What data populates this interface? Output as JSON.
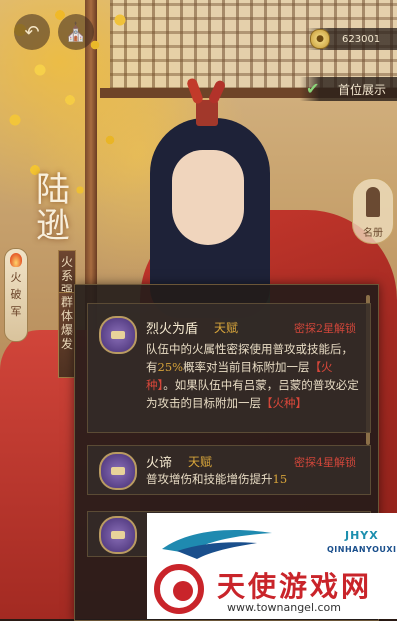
{
  "top_bar": {
    "currency_value": "623001",
    "showcase_label": "首位展示"
  },
  "character": {
    "name_chars": [
      "陆",
      "逊"
    ],
    "tags": [
      "火系强化",
      "群体爆发"
    ],
    "side_badge_chars": [
      "火",
      "破",
      "军"
    ],
    "famous_book_label": "名册"
  },
  "skills": [
    {
      "name": "烈火为盾",
      "type": "天赋",
      "unlock": "密探2星解锁",
      "desc_parts": [
        {
          "t": "队伍中的火属性密探使用普攻或技能后，有",
          "c": ""
        },
        {
          "t": "25%",
          "c": "hl"
        },
        {
          "t": "概率对当前目标附加一层",
          "c": ""
        },
        {
          "t": "【火种】",
          "c": "red"
        },
        {
          "t": "。如果队伍中有吕蒙，吕蒙的普攻必定为攻击的目标附加一层",
          "c": ""
        },
        {
          "t": "【火种】",
          "c": "red"
        }
      ]
    },
    {
      "name": "火谛",
      "type": "天赋",
      "unlock": "密探4星解锁",
      "desc_parts": [
        {
          "t": "普攻增伤和技能增伤提升",
          "c": ""
        },
        {
          "t": "15",
          "c": "hl"
        }
      ]
    }
  ],
  "watermark": {
    "code": "JHYX",
    "pinyin": "QINHANYOUXI",
    "title": "天使游戏网",
    "url": "www.townangel.com"
  },
  "colors": {
    "panel_bg": "#221c1a",
    "accent_gold": "#d9a63b",
    "unlock_red": "#d0463a",
    "robe_red": "#c8382d"
  }
}
